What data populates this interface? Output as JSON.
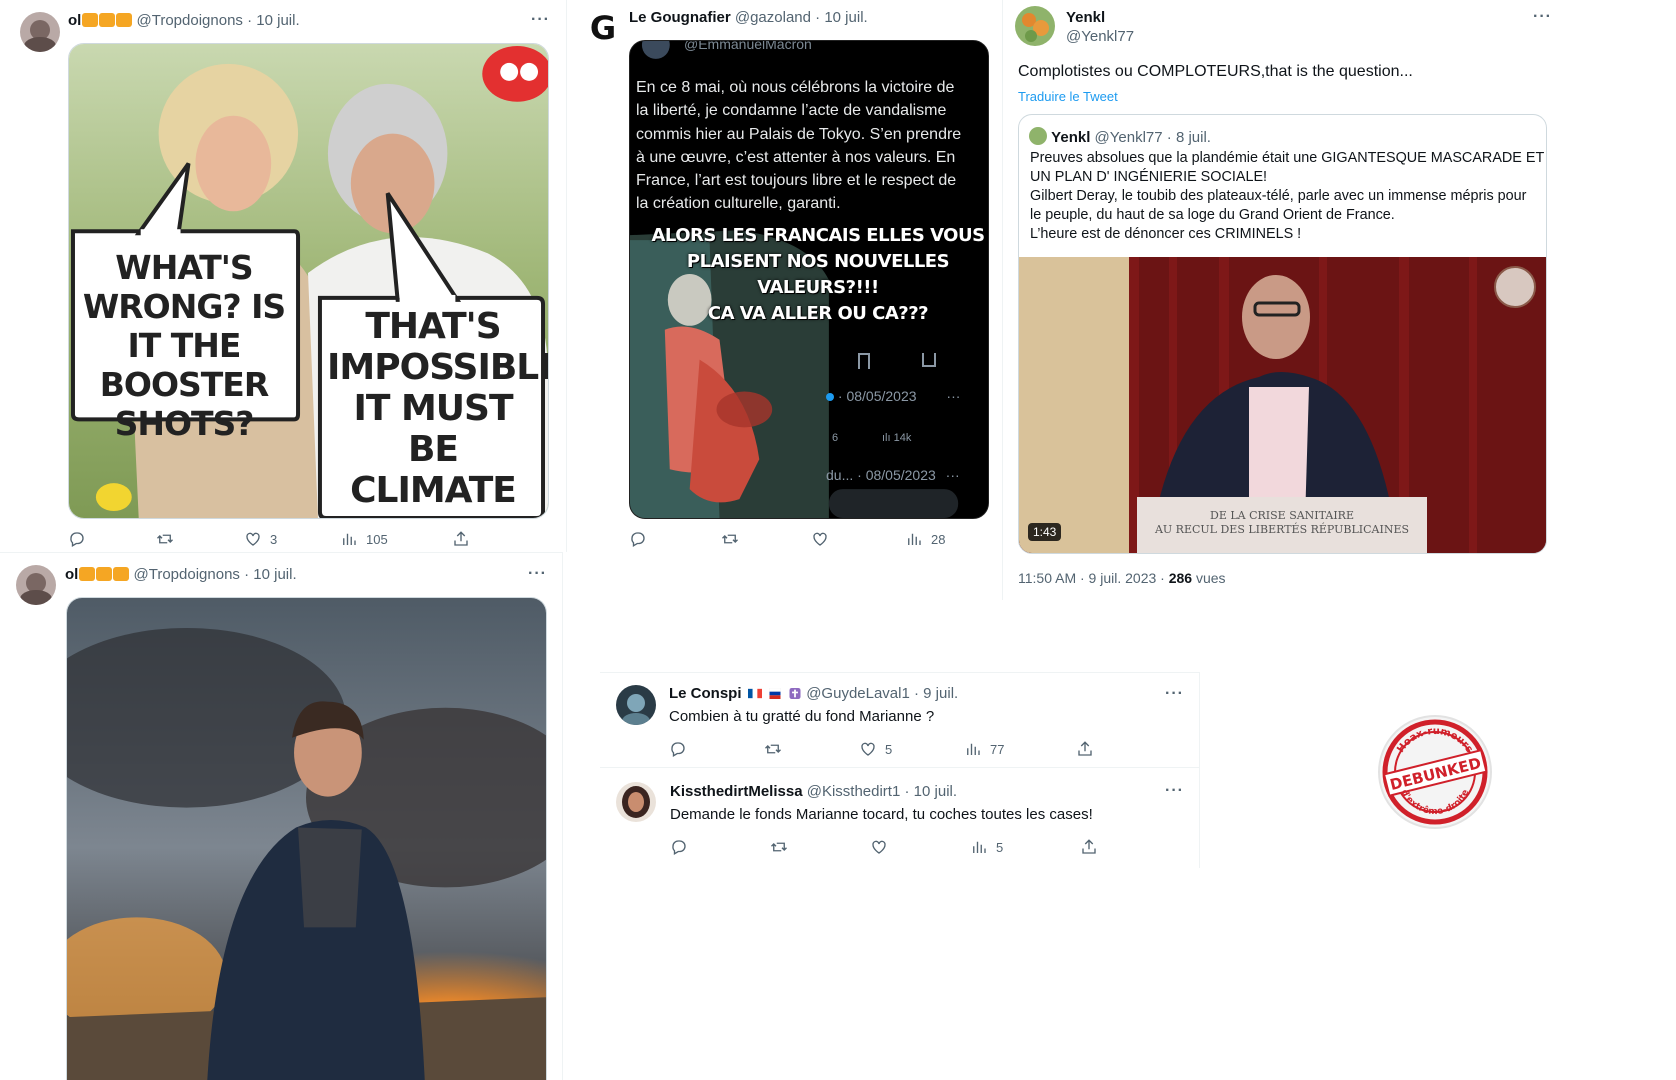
{
  "tweet1": {
    "display_name": "ol",
    "handle": "@Tropdoignons",
    "date": "10 juil.",
    "meme": {
      "bubble_left": "WHAT'S WRONG? IS IT THE BOOSTER SHOTS?",
      "bubble_right": "THAT'S IMPOSSIBLE, IT MUST BE CLIMATE CHANGE"
    },
    "likes": "3",
    "views": "105"
  },
  "tweet2": {
    "display_name": "Le Gougnafier",
    "handle": "@gazoland",
    "date": "10 juil.",
    "avatar_letter": "G",
    "embedded_handle": "@EmmanuelMacron",
    "embedded_text": "En ce 8 mai, où nous célébrons la victoire de\nla liberté, je condamne l’acte de vandalisme\ncommis hier au Palais de Tokyo. S’en prendre\nà une œuvre, c’est attenter à nos valeurs. En\nFrance, l’art est toujours libre et le respect de\nla création culturelle, garanti.",
    "caption": "ALORS LES FRANCAIS ELLES VOUS\nPLAISENT NOS NOUVELLES VALEURS?!!!\nCA VA ALLER OU CA???",
    "inner_date_1": "08/05/2023",
    "inner_count_1": "6",
    "inner_count_2": "14k",
    "inner_trunc": "du...",
    "inner_date_2": "08/05/2023",
    "views": "28"
  },
  "tweet3": {
    "display_name": "Yenkl",
    "handle": "@Yenkl77",
    "text": "Complotistes ou COMPLOTEURS,that is the question...",
    "translate": "Traduire le Tweet",
    "quote": {
      "display_name": "Yenkl",
      "handle": "@Yenkl77",
      "date": "8 juil.",
      "text": "Preuves absolues que la plandémie était une GIGANTESQUE MASCARADE  ET\nUN PLAN D' INGÉNIERIE SOCIALE!\nGilbert Deray, le toubib des plateaux-télé, parle avec un immense mépris pour\nle peuple, du haut de sa loge du Grand Orient de France.\nL’heure est de dénoncer ces CRIMINELS !",
      "banner_line1": "DE LA CRISE SANITAIRE",
      "banner_line2": "AU RECUL DES LIBERTÉS RÉPUBLICAINES",
      "duration": "1:43"
    },
    "timestamp": "11:50 AM · 9 juil. 2023 · ",
    "views_count": "286",
    "views_label": " vues"
  },
  "tweet4": {
    "display_name": "ol",
    "handle": "@Tropdoignons",
    "date": "10 juil."
  },
  "reply1": {
    "display_name": "Le Conspi",
    "handle": "@GuydeLaval1",
    "date": "9 juil.",
    "text": "Combien à tu gratté du fond Marianne ?",
    "likes": "5",
    "views": "77"
  },
  "reply2": {
    "display_name": "KissthedirtMelissa",
    "handle": "@Kissthedirt1",
    "date": "10 juil.",
    "text": "Demande le fonds Marianne tocard, tu coches toutes les cases!",
    "views": "5"
  },
  "stamp": {
    "top": "Hoax-rumeurs",
    "middle": "DEBUNKED",
    "bottom": "d'extrême-droite"
  },
  "common": {
    "sep": " · ",
    "more": "···"
  },
  "colors": {
    "accent": "#1d9bf0",
    "muted": "#536471",
    "stamp_red": "#d0202a"
  }
}
